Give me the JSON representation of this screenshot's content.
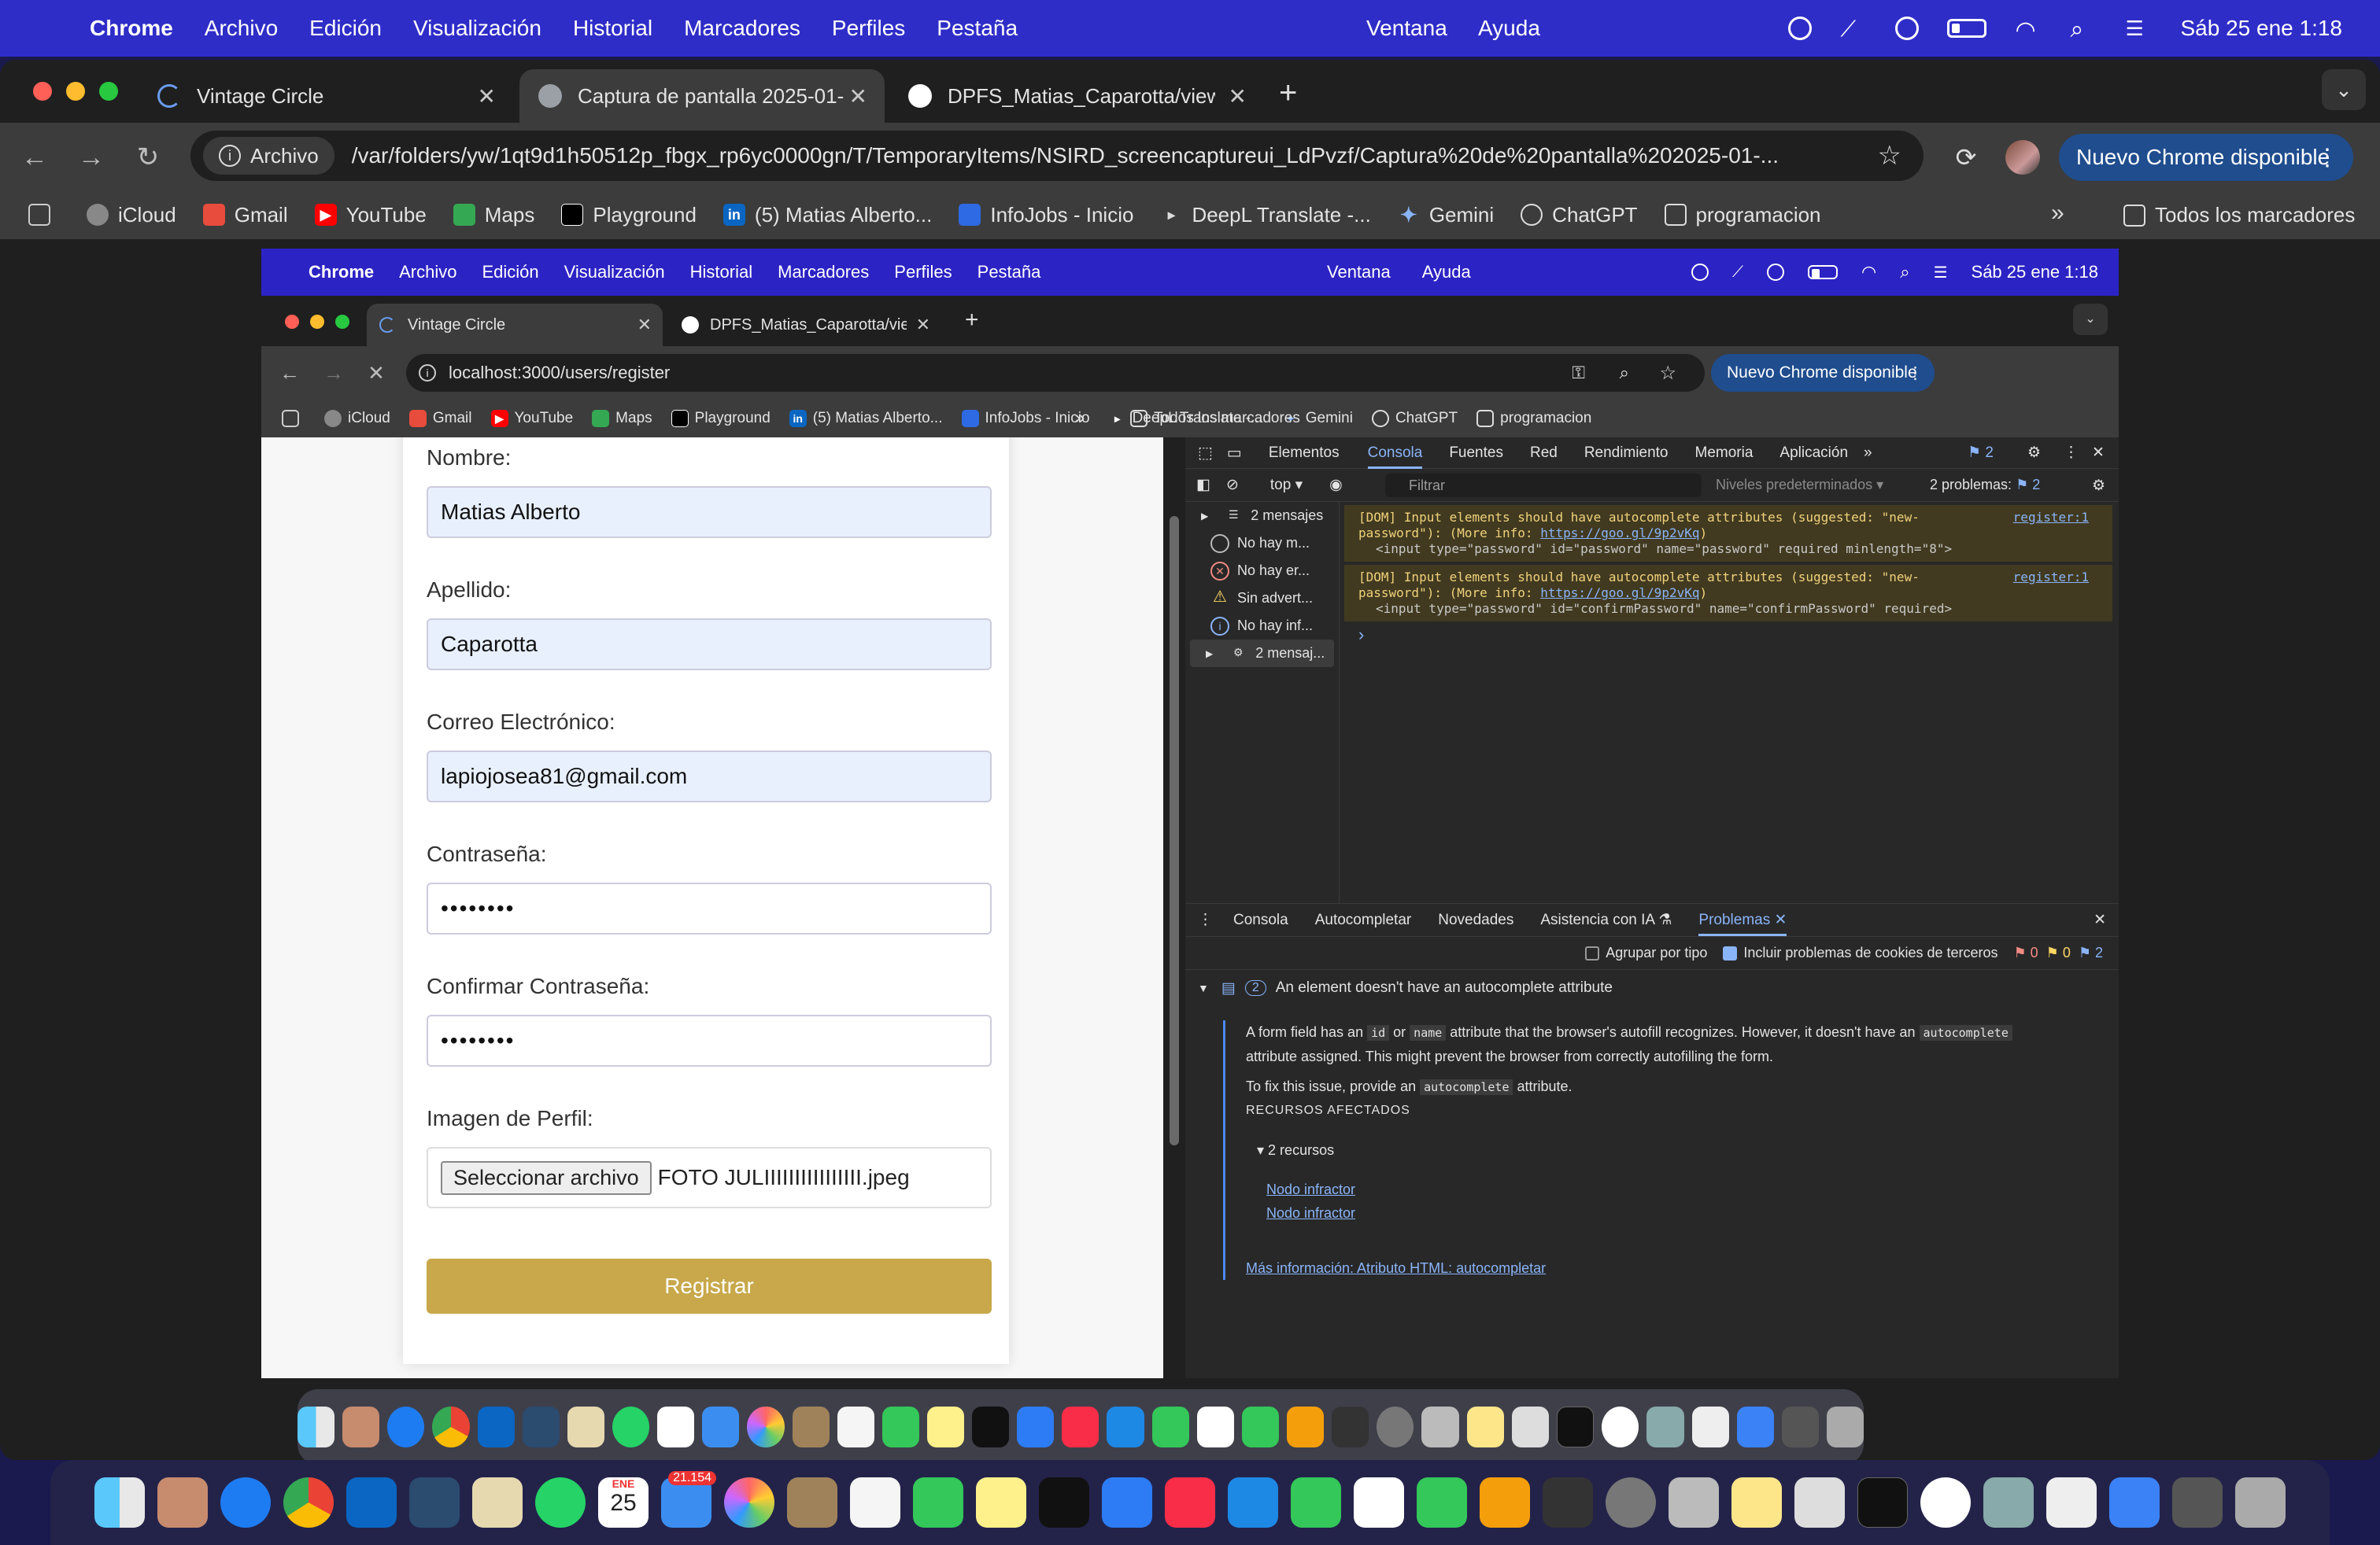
{
  "menubar": {
    "items": [
      "Chrome",
      "Archivo",
      "Edición",
      "Visualización",
      "Historial",
      "Marcadores",
      "Perfiles",
      "Pestaña"
    ],
    "right_items": [
      "Ventana",
      "Ayuda"
    ],
    "datetime": "Sáb 25 ene 1:18"
  },
  "outer_browser": {
    "tabs": [
      {
        "title": "Vintage Circle"
      },
      {
        "title": "Captura de pantalla 2025-01-"
      },
      {
        "title": "DPFS_Matias_Caparotta/view"
      }
    ],
    "omnibox_chip": "Archivo",
    "url": "/var/folders/yw/1qt9d1h50512p_fbgx_rp6yc0000gn/T/TemporaryItems/NSIRD_screencaptureui_LdPvzf/Captura%20de%20pantalla%202025-01-...",
    "update_button": "Nuevo Chrome disponible",
    "bookmarks": [
      "iCloud",
      "Gmail",
      "YouTube",
      "Maps",
      "Playground",
      "(5) Matias Alberto...",
      "InfoJobs - Inicio",
      "DeepL Translate -...",
      "Gemini",
      "ChatGPT",
      "programacion"
    ],
    "all_bookmarks": "Todos los marcadores"
  },
  "inner_browser": {
    "tabs": [
      {
        "title": "Vintage Circle"
      },
      {
        "title": "DPFS_Matias_Caparotta/view"
      }
    ],
    "url": "localhost:3000/users/register",
    "update_button": "Nuevo Chrome disponible",
    "bookmarks": [
      "iCloud",
      "Gmail",
      "YouTube",
      "Maps",
      "Playground",
      "(5) Matias Alberto...",
      "InfoJobs - Inicio",
      "DeepL Translate -...",
      "Gemini",
      "ChatGPT",
      "programacion"
    ],
    "all_bookmarks": "Todos los marcadores"
  },
  "form": {
    "fields": [
      {
        "label": "Nombre:",
        "value": "Matias Alberto"
      },
      {
        "label": "Apellido:",
        "value": "Caparotta"
      },
      {
        "label": "Correo Electrónico:",
        "value": "lapiojosea81@gmail.com"
      },
      {
        "label": "Contraseña:",
        "value": "••••••••"
      },
      {
        "label": "Confirmar Contraseña:",
        "value": "••••••••"
      }
    ],
    "image_label": "Imagen de Perfil:",
    "file_button": "Seleccionar archivo",
    "file_name": "FOTO JULIIIIIIIIIIIIIIII.jpeg",
    "submit": "Registrar"
  },
  "devtools": {
    "tabs": [
      "Elementos",
      "Consola",
      "Fuentes",
      "Red",
      "Rendimiento",
      "Memoria",
      "Aplicación"
    ],
    "issues_count": "2",
    "context": "top",
    "filter_placeholder": "Filtrar",
    "levels": "Niveles predeterminados",
    "problems": "2 problemas:",
    "problems_count": "2",
    "sidebar": [
      "2 mensajes",
      "No hay m...",
      "No hay er...",
      "Sin advert...",
      "No hay inf...",
      "2 mensaj..."
    ],
    "messages": [
      {
        "line1": "[DOM] Input elements should have autocomplete attributes (suggested: \"new-",
        "line2_pre": "password\"): (More info: ",
        "link": "https://goo.gl/9p2vKq",
        "line2_post": ")",
        "code": "<input type=\"password\" id=\"password\" name=\"password\" required minlength=\"8\">",
        "source": "register:1"
      },
      {
        "line1": "[DOM] Input elements should have autocomplete attributes (suggested: \"new-",
        "line2_pre": "password\"): (More info: ",
        "link": "https://goo.gl/9p2vKq",
        "line2_post": ")",
        "code": "<input type=\"password\" id=\"confirmPassword\" name=\"confirmPassword\" required>",
        "source": "register:1"
      }
    ],
    "drawer_tabs": [
      "Consola",
      "Autocompletar",
      "Novedades",
      "Asistencia con IA",
      "Problemas"
    ],
    "group_by_type": "Agrupar por tipo",
    "include_third_party": "Incluir problemas de cookies de terceros",
    "counts": {
      "errors": "0",
      "warnings": "0",
      "info": "2"
    },
    "issue": {
      "count": "2",
      "title": "An element doesn't have an autocomplete attribute",
      "desc_a": "A form field has an ",
      "code_id": "id",
      "desc_b": " or ",
      "code_name": "name",
      "desc_c": " attribute that the browser's autofill recognizes. However, it doesn't have an ",
      "code_auto": "autocomplete",
      "desc_d": "attribute assigned. This might prevent the browser from correctly autofilling the form.",
      "fix_a": "To fix this issue, provide an ",
      "code_auto2": "autocomplete",
      "fix_b": " attribute.",
      "resources_heading": "RECURSOS AFECTADOS",
      "resources": "2 recursos",
      "node1": "Nodo infractor",
      "node2": "Nodo infractor",
      "more_info": "Más información: Atributo HTML: autocompletar"
    }
  },
  "dock": {
    "calendar_month": "ENE",
    "calendar_day": "25",
    "mail_badge": "21.154"
  }
}
